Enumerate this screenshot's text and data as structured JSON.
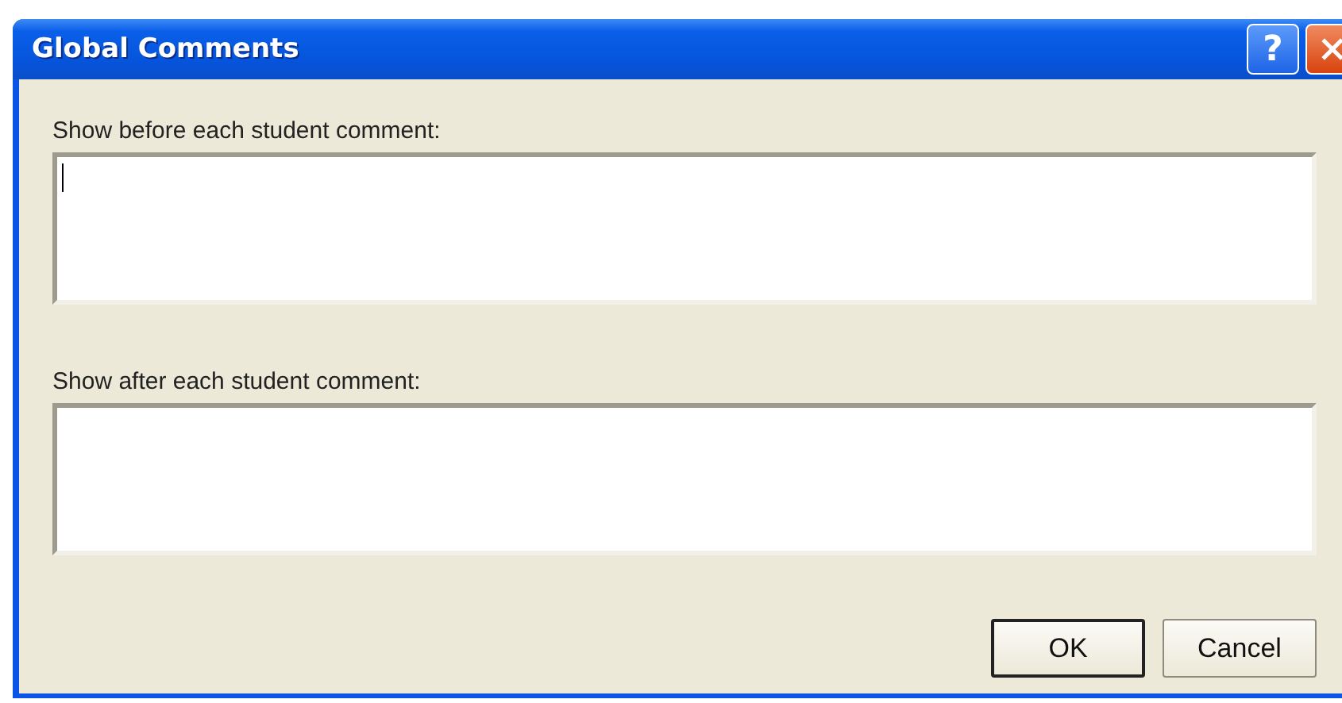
{
  "window": {
    "title": "Global Comments"
  },
  "title_buttons": [
    {
      "kind": "help",
      "label": "?"
    },
    {
      "kind": "close"
    }
  ],
  "fields": [
    {
      "label": "Show before each student comment:",
      "focused": true
    },
    {
      "label": "Show after each student comment:",
      "focused": false
    }
  ],
  "buttons": [
    {
      "label": "OK",
      "default": true
    },
    {
      "label": "Cancel",
      "default": false
    }
  ]
}
